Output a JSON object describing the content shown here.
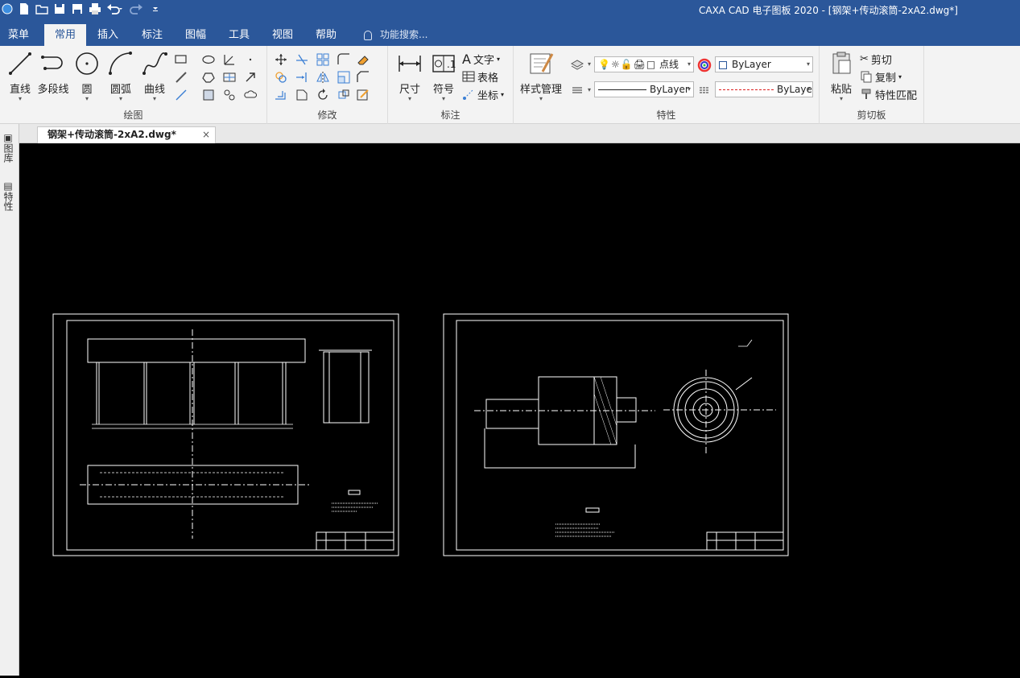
{
  "window": {
    "title": "CAXA CAD 电子图板 2020 - [钢架+传动滚筒-2xA2.dwg*]"
  },
  "quick_access": {
    "icons": [
      "app-icon",
      "new-icon",
      "open-icon",
      "save-icon",
      "save-as-icon",
      "print-icon",
      "undo-icon",
      "redo-icon",
      "customize-icon"
    ]
  },
  "tabs": [
    {
      "label": "菜单"
    },
    {
      "label": "常用"
    },
    {
      "label": "插入"
    },
    {
      "label": "标注"
    },
    {
      "label": "图幅"
    },
    {
      "label": "工具"
    },
    {
      "label": "视图"
    },
    {
      "label": "帮助"
    }
  ],
  "search_placeholder": "功能搜索...",
  "ribbon": {
    "draw": {
      "label": "绘图",
      "buttons": [
        {
          "label": "直线"
        },
        {
          "label": "多段线"
        },
        {
          "label": "圆"
        },
        {
          "label": "圆弧"
        },
        {
          "label": "曲线"
        }
      ]
    },
    "modify": {
      "label": "修改"
    },
    "annotate": {
      "label": "标注",
      "size": "尺寸",
      "symbol": "符号",
      "text": "文字",
      "table": "表格",
      "coord": "坐标"
    },
    "properties": {
      "label": "特性",
      "style_manager": "样式管理",
      "layer": "点线",
      "color": "ByLayer",
      "linetype": "ByLayer",
      "linetype2": "ByLaye"
    },
    "clipboard": {
      "label": "剪切板",
      "paste": "粘贴",
      "cut": "剪切",
      "copy": "复制",
      "match": "特性匹配"
    }
  },
  "document_tab": {
    "name": "钢架+传动滚筒-2xA2.dwg*",
    "close": "×"
  },
  "side_panel": {
    "tab1": "图库",
    "tab2": "特性"
  },
  "colors": {
    "titlebar": "#2b579a",
    "ribbon": "#f3f3f3",
    "canvas": "#000000",
    "drawing": "#ffffff"
  }
}
